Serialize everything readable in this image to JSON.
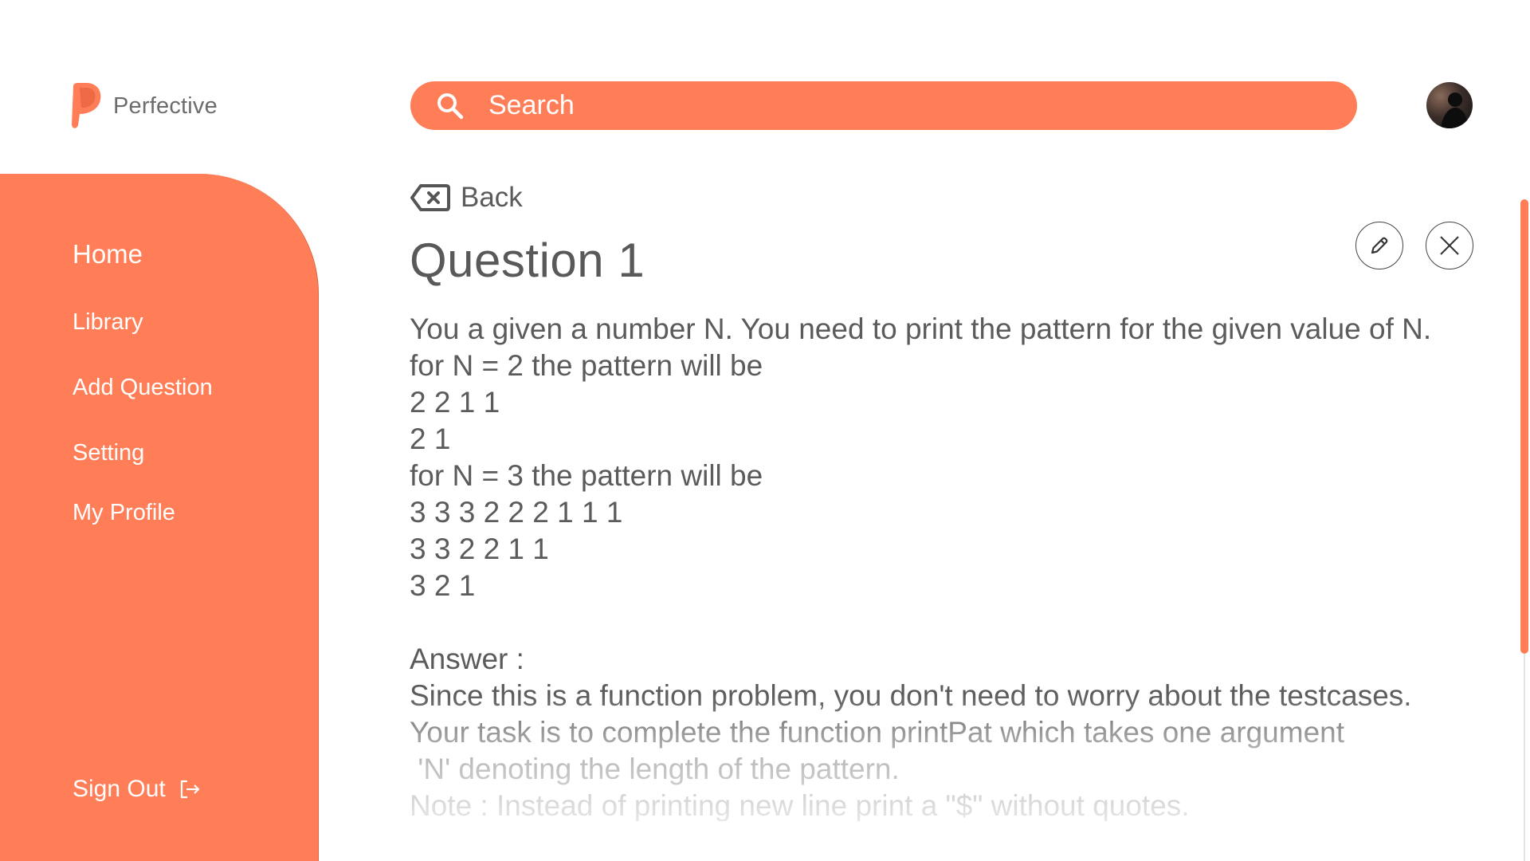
{
  "app": {
    "name": "Perfective",
    "logo_icon": "perfective-logo-icon",
    "accent_color": "#ff7e57"
  },
  "search": {
    "placeholder": "Search",
    "icon": "search-icon"
  },
  "avatar": {
    "icon": "user-avatar"
  },
  "sidebar": {
    "items": [
      {
        "label": "Home",
        "active": true
      },
      {
        "label": "Library",
        "active": false
      },
      {
        "label": "Add Question",
        "active": false
      },
      {
        "label": "Setting",
        "active": false
      },
      {
        "label": "My Profile",
        "active": false
      }
    ],
    "sign_out": {
      "label": "Sign Out",
      "icon": "sign-out-icon"
    }
  },
  "question": {
    "back_label": "Back",
    "back_icon": "backspace-icon",
    "title": "Question 1",
    "edit_icon": "pencil-icon",
    "close_icon": "close-icon",
    "body_lines": [
      "You a given a number N. You need to print the pattern for the given value of N.",
      "for N = 2 the pattern will be",
      "2 2 1 1",
      "2 1",
      "for N = 3 the pattern will be",
      "3 3 3 2 2 2 1 1 1",
      "3 3 2 2 1 1",
      "3 2 1"
    ],
    "answer_label": "Answer :",
    "answer_lines": [
      "Since this is a function problem, you don't need to worry about the testcases.",
      "Your task is to complete the function printPat which takes one argument",
      " 'N' denoting the length of the pattern.",
      "Note : Instead of printing new line print a \"$\" without quotes."
    ]
  }
}
